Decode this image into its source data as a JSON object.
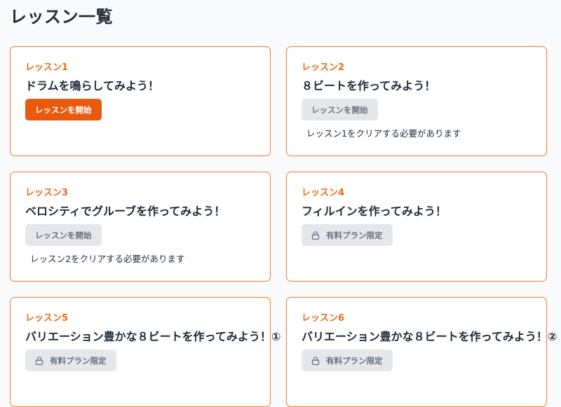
{
  "page": {
    "title": "レッスン一覧"
  },
  "colors": {
    "accent": "#ea5a0c",
    "card_border": "#f07a2a",
    "disabled_bg": "#e5e7eb"
  },
  "lessons": [
    {
      "label": "レッスン1",
      "title": "ドラムを鳴らしてみよう！",
      "button_label": "レッスンを開始",
      "state": "available",
      "note": ""
    },
    {
      "label": "レッスン2",
      "title": "８ビートを作ってみよう！",
      "button_label": "レッスンを開始",
      "state": "locked-progress",
      "note": "レッスン1をクリアする必要があります"
    },
    {
      "label": "レッスン3",
      "title": "ベロシティでグルーブを作ってみよう！",
      "button_label": "レッスンを開始",
      "state": "locked-progress",
      "note": "レッスン2をクリアする必要があります"
    },
    {
      "label": "レッスン4",
      "title": "フィルインを作ってみよう！",
      "button_label": "有料プラン限定",
      "button_icon": "lock-icon",
      "state": "paid",
      "note": ""
    },
    {
      "label": "レッスン5",
      "title": "バリエーション豊かな８ビートを作ってみよう！①",
      "button_label": "有料プラン限定",
      "button_icon": "lock-icon",
      "state": "paid",
      "note": ""
    },
    {
      "label": "レッスン6",
      "title": "バリエーション豊かな８ビートを作ってみよう！②",
      "button_label": "有料プラン限定",
      "button_icon": "lock-icon",
      "state": "paid",
      "note": ""
    }
  ]
}
